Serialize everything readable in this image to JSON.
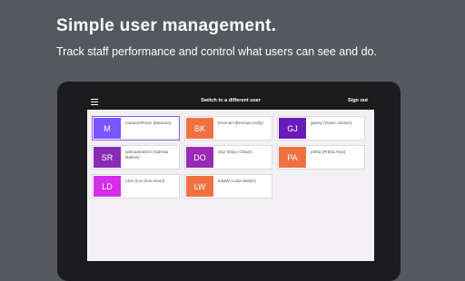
{
  "hero": {
    "title": "Simple user management.",
    "subtitle": "Track staff performance and control what users can see and do."
  },
  "appbar": {
    "title": "Switch to a different user",
    "signout_label": "Sign out",
    "menu_icon": "hamburger-icon"
  },
  "users": [
    {
      "initials": "M",
      "name": "marianaFlorez (Mariana)",
      "color": "#7b53ff",
      "selected": true
    },
    {
      "initials": "BK",
      "name": "brennan (Brennan Kelly)",
      "color": "#f07040",
      "selected": false
    },
    {
      "initials": "GJ",
      "name": "gwesy (Gwen Jansen)",
      "color": "#6a1bb8",
      "selected": false
    },
    {
      "initials": "SR",
      "name": "salmaanrahmi (Salmaa Rahimi)",
      "color": "#8a2bb6",
      "selected": false
    },
    {
      "initials": "DO",
      "name": "doyi (Dayo Oluwe)",
      "color": "#9a2ab6",
      "selected": false
    },
    {
      "initials": "PA",
      "name": "pritha (Pritha Arya)",
      "color": "#f07040",
      "selected": false
    },
    {
      "initials": "LD",
      "name": "LDH (Lee Doe-Heun)",
      "color": "#d62ee8",
      "selected": false
    },
    {
      "initials": "LW",
      "name": "lukaW (Luka Weber)",
      "color": "#f07040",
      "selected": false
    }
  ]
}
